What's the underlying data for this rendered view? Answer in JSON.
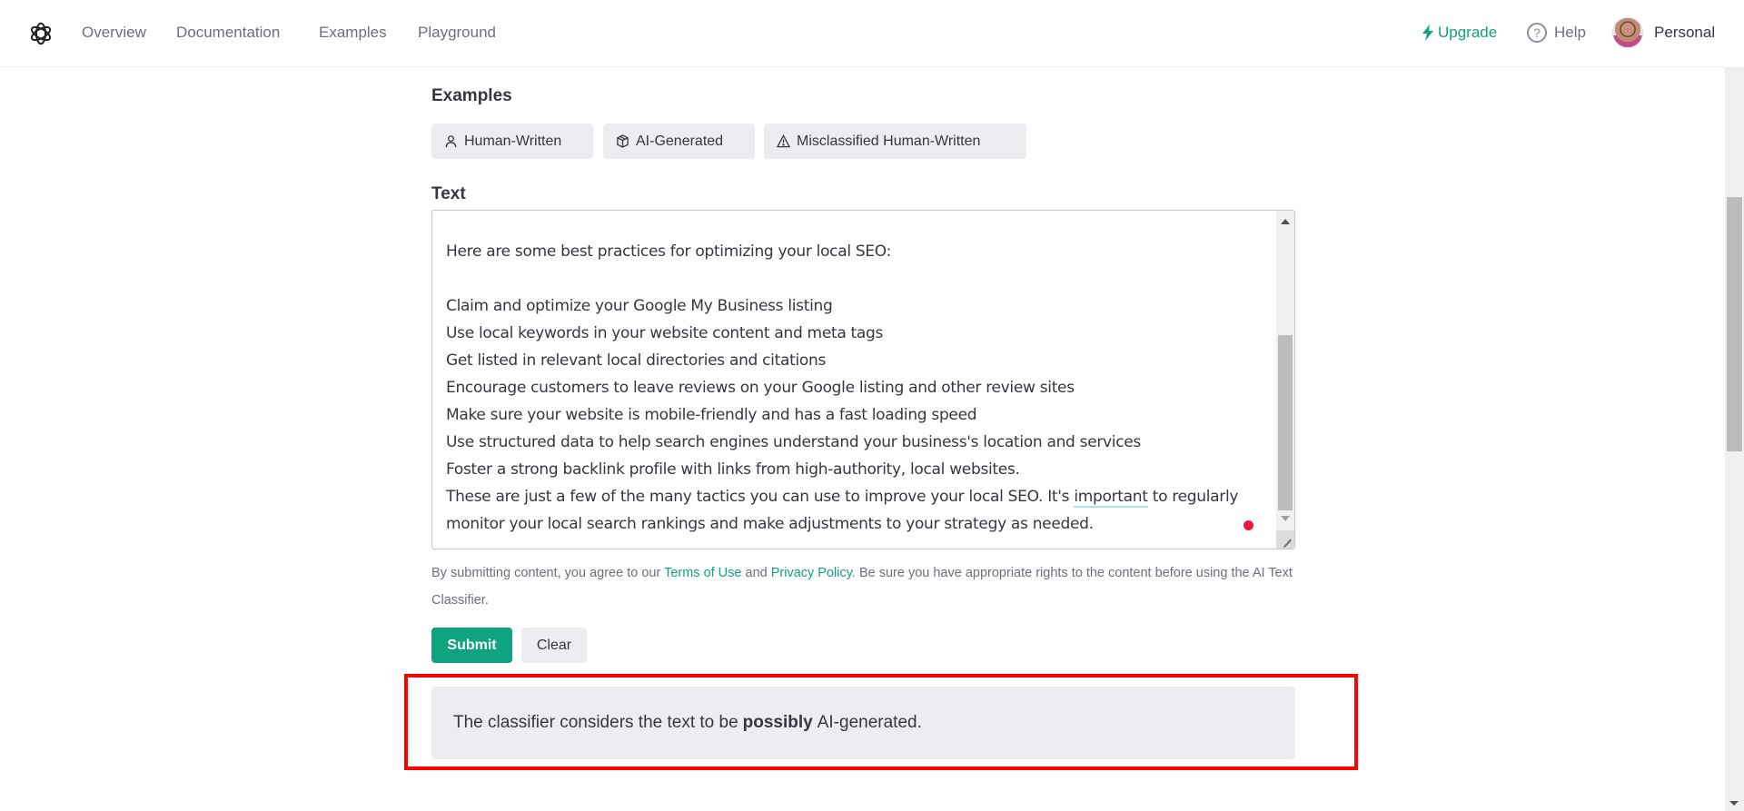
{
  "header": {
    "logo": "openai-logo-icon",
    "nav": [
      "Overview",
      "Documentation",
      "Examples",
      "Playground"
    ],
    "upgrade_label": "Upgrade",
    "help_label": "Help",
    "account_label": "Personal"
  },
  "examples": {
    "title": "Examples",
    "buttons": [
      {
        "label": "Human-Written",
        "icon": "person-icon"
      },
      {
        "label": "AI-Generated",
        "icon": "cube-icon"
      },
      {
        "label": "Misclassified Human-Written",
        "icon": "warning-icon"
      }
    ]
  },
  "text_section": {
    "title": "Text",
    "lines": [
      "Here are some best practices for optimizing your local SEO:",
      "",
      "Claim and optimize your Google My Business listing",
      "Use local keywords in your website content and meta tags",
      "Get listed in relevant local directories and citations",
      "Encourage customers to leave reviews on your Google listing and other review sites",
      "Make sure your website is mobile-friendly and has a fast loading speed",
      "Use structured data to help search engines understand your business's location and services",
      "Foster a strong backlink profile with links from high-authority, local websites."
    ],
    "last_para_before": "These are just a few of the many tactics you can use to improve your local SEO. It's ",
    "last_para_highlight": "important",
    "last_para_after": " to regularly monitor your local search rankings and make adjustments to your strategy as needed."
  },
  "disclaimer": {
    "prefix": "By submitting content, you agree to our ",
    "terms_link": "Terms of Use",
    "and": " and ",
    "privacy_link": "Privacy Policy",
    "suffix": ". Be sure you have appropriate rights to the content before using the AI Text Classifier."
  },
  "actions": {
    "submit_label": "Submit",
    "clear_label": "Clear"
  },
  "result": {
    "prefix": "The classifier considers the text to be",
    "emphasis": "possibly",
    "suffix": "AI-generated."
  },
  "colors": {
    "accent": "#10a37f",
    "highlight_box": "#ff0000",
    "chip_bg": "#ececf1"
  }
}
